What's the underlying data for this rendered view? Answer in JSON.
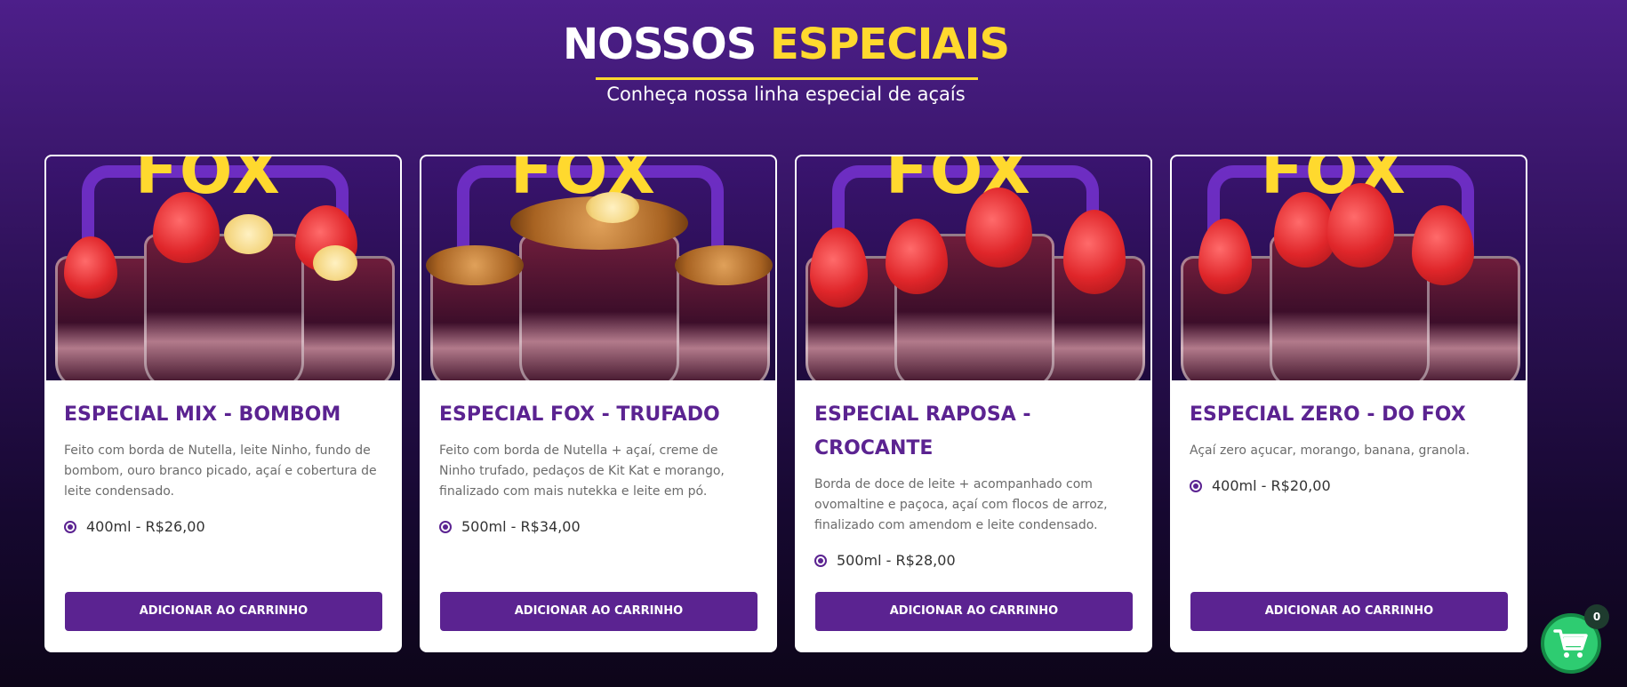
{
  "header": {
    "title_part1": "NOSSOS ",
    "title_part2": "ESPECIAIS",
    "subtitle": "Conheça nossa linha especial de açaís"
  },
  "colors": {
    "accent_yellow": "#ffd92e",
    "brand_purple": "#5b2391",
    "cart_green": "#2ecc71"
  },
  "products": [
    {
      "title": "ESPECIAL MIX - BOMBOM",
      "description": "Feito com borda de Nutella, leite Ninho, fundo de bombom, ouro branco picado, açaí e cobertura de leite condensado.",
      "option": "400ml - R$26,00",
      "button": "ADICIONAR AO CARRINHO",
      "image_brand": "FOX"
    },
    {
      "title": "ESPECIAL FOX - TRUFADO",
      "description": "Feito com borda de Nutella + açaí, creme de Ninho trufado, pedaços de Kit Kat e morango, finalizado com mais nutekka e leite em pó.",
      "option": "500ml - R$34,00",
      "button": "ADICIONAR AO CARRINHO",
      "image_brand": "FOX"
    },
    {
      "title": "ESPECIAL RAPOSA - CROCANTE",
      "description": "Borda de doce de leite + acompanhado com ovomaltine e paçoca, açaí com flocos de arroz, finalizado com amendom e leite condensado.",
      "option": "500ml - R$28,00",
      "button": "ADICIONAR AO CARRINHO",
      "image_brand": "FOX"
    },
    {
      "title": "ESPECIAL ZERO - DO FOX",
      "description": "Açaí zero açucar, morango, banana, granola.",
      "option": "400ml - R$20,00",
      "button": "ADICIONAR AO CARRINHO",
      "image_brand": "FOX"
    }
  ],
  "cart": {
    "count": "0",
    "icon": "shopping-cart-icon"
  }
}
